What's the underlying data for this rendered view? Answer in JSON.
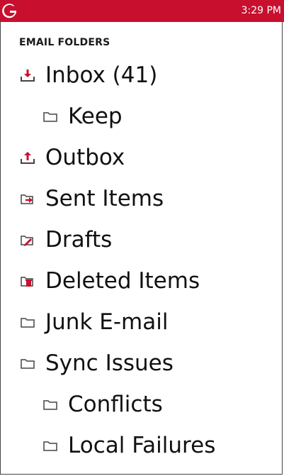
{
  "status_bar": {
    "time": "3:29 PM",
    "accent_color": "#c8102e"
  },
  "section": {
    "title": "EMAIL FOLDERS"
  },
  "folders": [
    {
      "label": "Inbox (41)",
      "icon": "inbox-icon",
      "level": 0
    },
    {
      "label": "Keep",
      "icon": "folder-icon",
      "level": 1
    },
    {
      "label": "Outbox",
      "icon": "outbox-icon",
      "level": 0
    },
    {
      "label": "Sent Items",
      "icon": "sent-items-icon",
      "level": 0
    },
    {
      "label": "Drafts",
      "icon": "drafts-icon",
      "level": 0
    },
    {
      "label": "Deleted Items",
      "icon": "deleted-items-icon",
      "level": 0
    },
    {
      "label": "Junk E-mail",
      "icon": "folder-icon",
      "level": 0
    },
    {
      "label": "Sync Issues",
      "icon": "folder-icon",
      "level": 0
    },
    {
      "label": "Conflicts",
      "icon": "folder-icon",
      "level": 1
    },
    {
      "label": "Local Failures",
      "icon": "folder-icon",
      "level": 1
    }
  ]
}
